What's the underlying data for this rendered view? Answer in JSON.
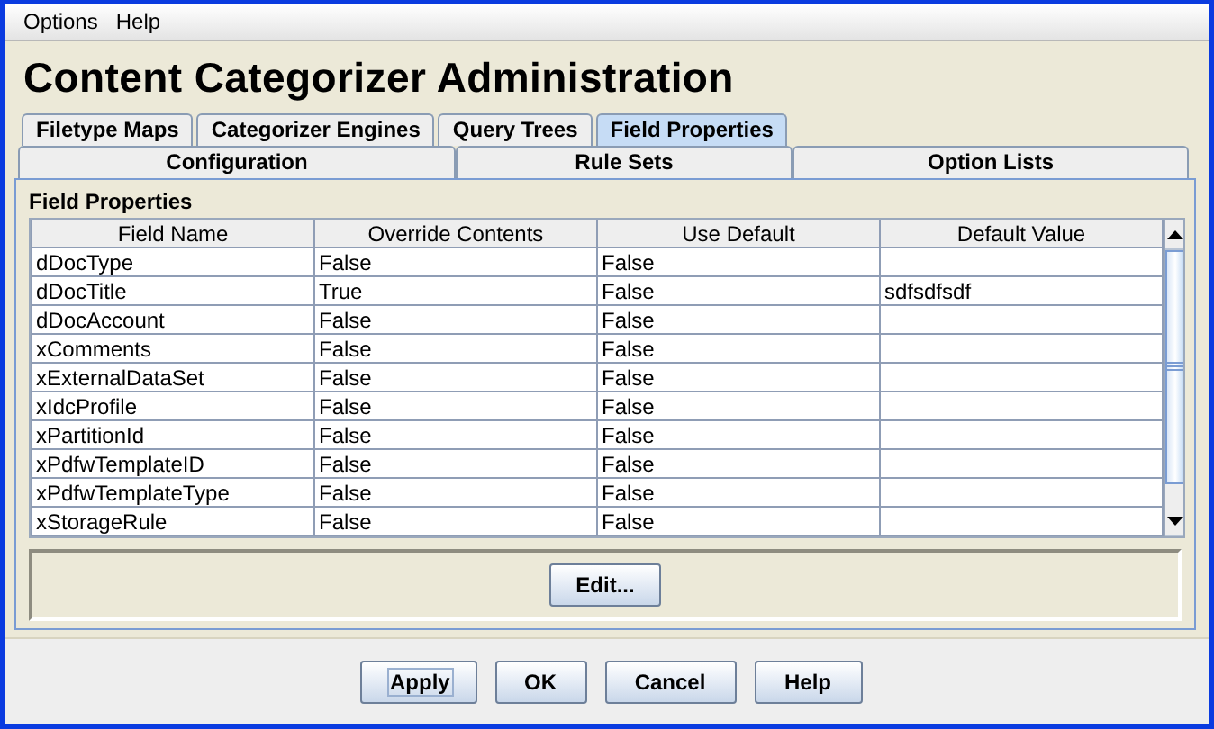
{
  "menu": [
    {
      "label": "Options"
    },
    {
      "label": "Help"
    }
  ],
  "title": "Content Categorizer Administration",
  "tab_rows": [
    {
      "tabs": [
        {
          "label": "Filetype Maps",
          "selected": false
        },
        {
          "label": "Categorizer Engines",
          "selected": false
        },
        {
          "label": "Query Trees",
          "selected": false
        },
        {
          "label": "Field Properties",
          "selected": true
        }
      ]
    },
    {
      "tabs": [
        {
          "label": "Configuration",
          "selected": false
        },
        {
          "label": "Rule Sets",
          "selected": false
        },
        {
          "label": "Option Lists",
          "selected": false
        }
      ]
    }
  ],
  "panel_title": "Field Properties",
  "table": {
    "columns": [
      "Field Name",
      "Override Contents",
      "Use Default",
      "Default Value"
    ],
    "rows": [
      [
        "dDocType",
        "False",
        "False",
        ""
      ],
      [
        "dDocTitle",
        "True",
        "False",
        "sdfsdfsdf"
      ],
      [
        "dDocAccount",
        "False",
        "False",
        ""
      ],
      [
        "xComments",
        "False",
        "False",
        ""
      ],
      [
        "xExternalDataSet",
        "False",
        "False",
        ""
      ],
      [
        "xIdcProfile",
        "False",
        "False",
        ""
      ],
      [
        "xPartitionId",
        "False",
        "False",
        ""
      ],
      [
        "xPdfwTemplateID",
        "False",
        "False",
        ""
      ],
      [
        "xPdfwTemplateType",
        "False",
        "False",
        ""
      ],
      [
        "xStorageRule",
        "False",
        "False",
        ""
      ]
    ]
  },
  "edit_button": "Edit...",
  "buttons": [
    {
      "label": "Apply",
      "focused": true
    },
    {
      "label": "OK",
      "focused": false
    },
    {
      "label": "Cancel",
      "focused": false
    },
    {
      "label": "Help",
      "focused": false
    }
  ]
}
